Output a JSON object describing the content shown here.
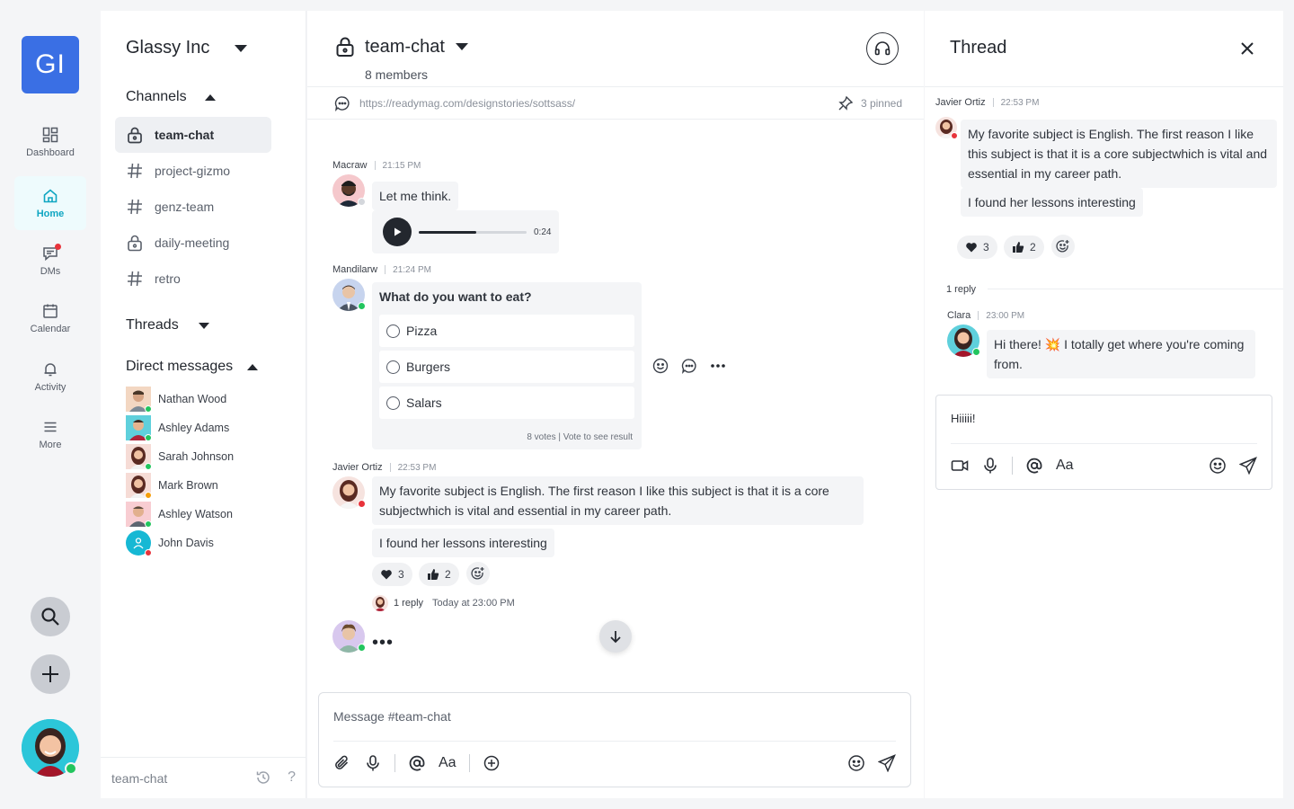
{
  "workspace": {
    "initials": "GI",
    "name": "Glassy Inc"
  },
  "rail": {
    "items": [
      {
        "label": "Dashboard",
        "icon": "dashboard-icon"
      },
      {
        "label": "Home",
        "icon": "home-icon"
      },
      {
        "label": "DMs",
        "icon": "dm-icon"
      },
      {
        "label": "Calendar",
        "icon": "calendar-icon"
      },
      {
        "label": "Activity",
        "icon": "bell-icon"
      },
      {
        "label": "More",
        "icon": "menu-icon"
      }
    ]
  },
  "sidebar": {
    "channels_title": "Channels",
    "channels": [
      {
        "name": "team-chat",
        "icon": "lock-icon"
      },
      {
        "name": "project-gizmo",
        "icon": "hash-icon"
      },
      {
        "name": "genz-team",
        "icon": "hash-icon"
      },
      {
        "name": "daily-meeting",
        "icon": "lock-icon"
      },
      {
        "name": "retro",
        "icon": "hash-icon"
      }
    ],
    "threads_title": "Threads",
    "dms_title": "Direct messages",
    "dms": [
      {
        "name": "Nathan Wood",
        "status": "online"
      },
      {
        "name": "Ashley Adams",
        "status": "online"
      },
      {
        "name": "Sarah Johnson",
        "status": "online"
      },
      {
        "name": "Mark Brown",
        "status": "busy"
      },
      {
        "name": "Ashley Watson",
        "status": "online"
      },
      {
        "name": "John Davis",
        "status": "busy"
      }
    ],
    "footer_label": "team-chat"
  },
  "channel": {
    "name": "team-chat",
    "members": "8 members",
    "pinned_link": "https://readymag.com/designstories/sottsass/",
    "pinned_count": "3 pinned"
  },
  "messages": {
    "m1": {
      "author": "Macraw",
      "time": "21:15 PM",
      "text": "Let me think.",
      "audio_duration": "0:24",
      "audio_progress": 0.53
    },
    "m2": {
      "author": "Mandilarw",
      "time": "21:24 PM",
      "poll_question": "What do you want to eat?",
      "options": [
        "Pizza",
        "Burgers",
        "Salars"
      ],
      "votes": "8 votes | Vote to see result"
    },
    "m3": {
      "author": "Javier Ortiz",
      "time": "22:53 PM",
      "text1": "My favorite subject is English. The first reason I like this subject is that it is a core subjectwhich is vital and essential in my career path.",
      "text2": "I found her lessons interesting",
      "reactions": [
        {
          "icon": "heart-icon",
          "count": "3"
        },
        {
          "icon": "thumbs-up-icon",
          "count": "2"
        }
      ],
      "replies": "1 reply",
      "reply_time": "Today at 23:00 PM"
    },
    "typing": "•••"
  },
  "composer": {
    "placeholder": "Message #team-chat"
  },
  "thread": {
    "title": "Thread",
    "parent": {
      "author": "Javier Ortiz",
      "time": "22:53 PM",
      "text1": "My favorite subject is English. The first reason I like this subject is that it is a core subjectwhich is vital and essential in my career path.",
      "text2": "I found her lessons interesting",
      "reactions": [
        {
          "icon": "heart-icon",
          "count": "3"
        },
        {
          "icon": "thumbs-up-icon",
          "count": "2"
        }
      ]
    },
    "reply_count": "1 reply",
    "reply": {
      "author": "Clara",
      "time": "23:00 PM",
      "text": "Hi there! 💥 I totally get where you're coming from."
    },
    "composer_value": "Hiiiii!",
    "aa_label": "Aa"
  },
  "colors": {
    "accent": "#3a6fe4",
    "active": "#0fa6c2",
    "online": "#22c55e",
    "busy": "#e8333b"
  }
}
